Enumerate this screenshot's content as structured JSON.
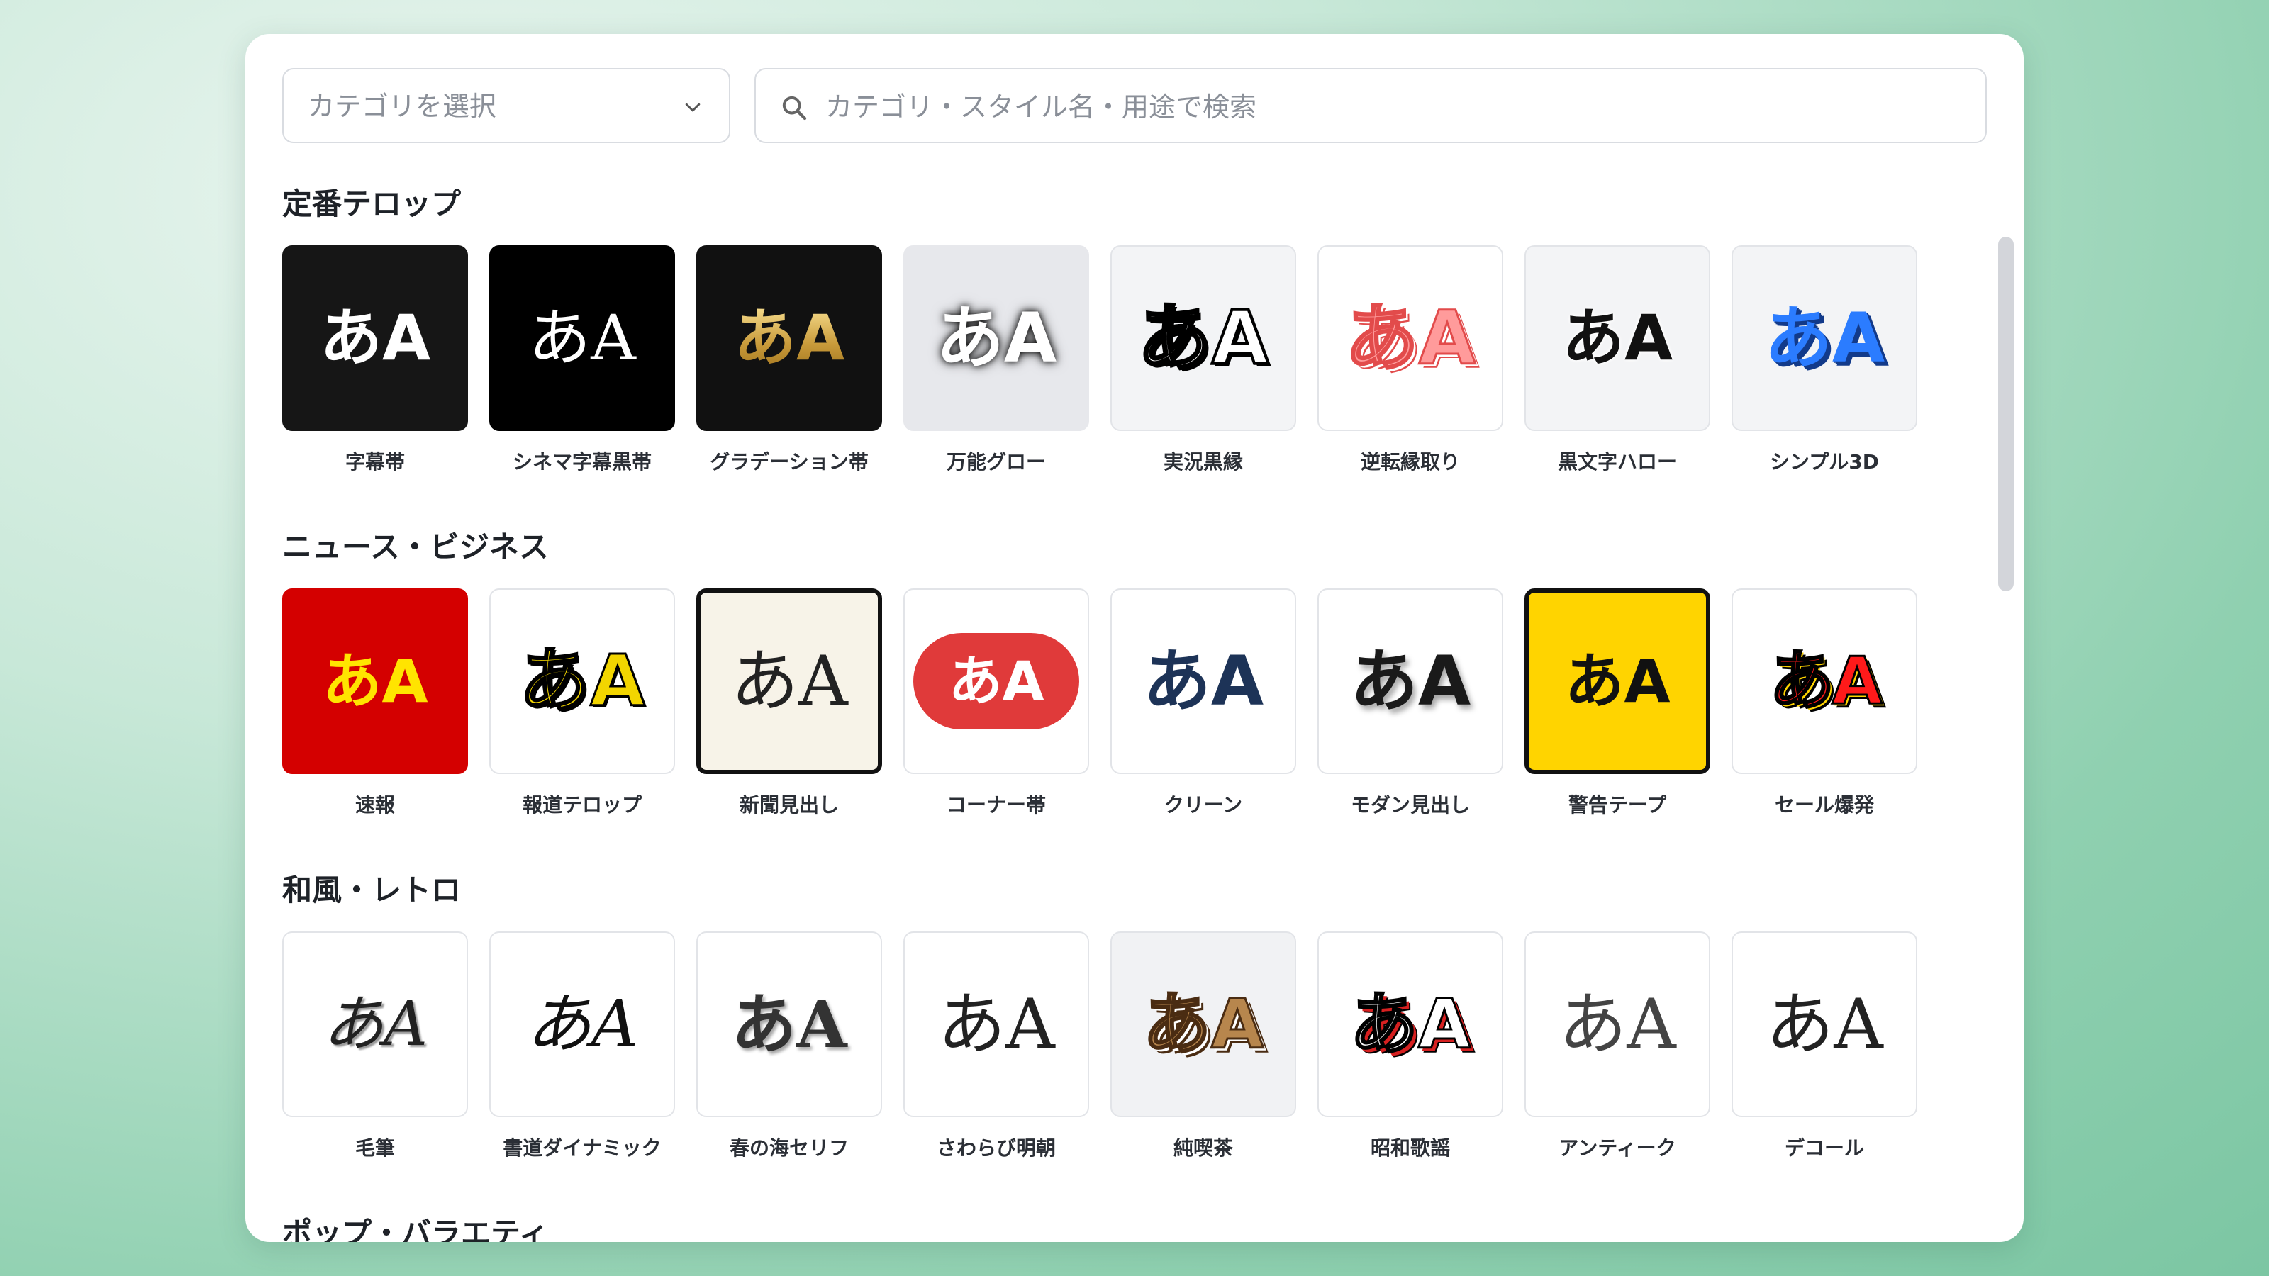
{
  "toolbar": {
    "category_placeholder": "カテゴリを選択",
    "search_placeholder": "カテゴリ・スタイル名・用途で検索"
  },
  "sections": [
    {
      "title": "定番テロップ",
      "items": [
        {
          "sample": "あA",
          "label": "字幕帯"
        },
        {
          "sample": "あA",
          "label": "シネマ字幕黒帯"
        },
        {
          "sample": "あA",
          "label": "グラデーション帯"
        },
        {
          "sample": "あA",
          "label": "万能グロー"
        },
        {
          "sample": "あA",
          "label": "実況黒縁"
        },
        {
          "sample": "あA",
          "label": "逆転縁取り"
        },
        {
          "sample": "あA",
          "label": "黒文字ハロー"
        },
        {
          "sample": "あA",
          "label": "シンプル3D"
        }
      ]
    },
    {
      "title": "ニュース・ビジネス",
      "items": [
        {
          "sample": "あA",
          "label": "速報"
        },
        {
          "sample": "あA",
          "label": "報道テロップ"
        },
        {
          "sample": "あA",
          "label": "新聞見出し"
        },
        {
          "sample": "あA",
          "label": "コーナー帯"
        },
        {
          "sample": "あA",
          "label": "クリーン"
        },
        {
          "sample": "あA",
          "label": "モダン見出し"
        },
        {
          "sample": "あA",
          "label": "警告テープ"
        },
        {
          "sample": "あA",
          "label": "セール爆発"
        }
      ]
    },
    {
      "title": "和風・レトロ",
      "items": [
        {
          "sample": "あA",
          "label": "毛筆"
        },
        {
          "sample": "あA",
          "label": "書道ダイナミック"
        },
        {
          "sample": "あA",
          "label": "春の海セリフ"
        },
        {
          "sample": "あA",
          "label": "さわらび明朝"
        },
        {
          "sample": "あA",
          "label": "純喫茶"
        },
        {
          "sample": "あA",
          "label": "昭和歌謡"
        },
        {
          "sample": "あA",
          "label": "アンティーク"
        },
        {
          "sample": "あA",
          "label": "デコール"
        }
      ]
    },
    {
      "title": "ポップ・バラエティ",
      "items": []
    }
  ],
  "icons": {
    "category_chevron": "chevron-down-icon",
    "search": "search-icon"
  }
}
